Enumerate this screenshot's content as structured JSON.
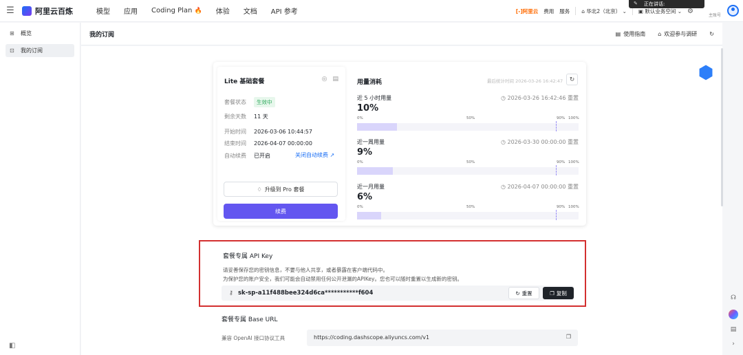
{
  "topbar": {
    "brand": "阿里云百炼",
    "tabs": [
      "模型",
      "应用",
      "Coding Plan",
      "体验",
      "文档",
      "API 参考"
    ],
    "aliyun_logo": "[-]阿里云",
    "fee": "费用",
    "service": "服务",
    "region": "华北2（北京）",
    "workspace": "默认业务空间",
    "speaking": "正在讲话:",
    "account": "主账号"
  },
  "sidebar": {
    "items": [
      {
        "label": "概览",
        "icon": "grid-icon"
      },
      {
        "label": "我的订阅",
        "icon": "subscription-icon"
      }
    ]
  },
  "header": {
    "title": "我的订阅",
    "guide": "使用指南",
    "survey": "欢迎参与调研"
  },
  "plan": {
    "title": "Lite 基础套餐",
    "status_label": "套餐状态",
    "status_value": "生效中",
    "days_label": "剩余天数",
    "days_value": "11 天",
    "start_label": "开始时间",
    "start_value": "2026-03-06 10:44:57",
    "end_label": "结束时间",
    "end_value": "2026-04-07 00:00:00",
    "auto_label": "自动续费",
    "auto_value": "已开启",
    "auto_link": "关闭自动续费",
    "upgrade": "升级到 Pro 套餐",
    "pay": "续费"
  },
  "usage": {
    "title": "用量消耗",
    "stat_time": "最后统计时间 2026-03-26 16:42:47",
    "ticks": [
      "0%",
      "50%",
      "90%",
      "100%"
    ],
    "blocks": [
      {
        "label": "近 5 小时用量",
        "reset": "2026-03-26 16:42:46 重置",
        "pct": "10%",
        "value": 0.1
      },
      {
        "label": "近一周用量",
        "reset": "2026-03-30 00:00:00 重置",
        "pct": "9%",
        "value": 0.09
      },
      {
        "label": "近一月用量",
        "reset": "2026-04-07 00:00:00 重置",
        "pct": "6%",
        "value": 0.06
      }
    ]
  },
  "apikey": {
    "title": "套餐专属 API Key",
    "desc1": "请妥善保存您的密钥信息，不要与他人共享，或者暴露在客户端代码中。",
    "desc2": "为保护您的账户安全，我们可能会自动禁用任何公开泄漏的APIKey。您也可以随时重置以生成新的密钥。",
    "key": "sk-sp-a11f488bee324d6ca***********f604",
    "reset": "重置",
    "copy": "复制"
  },
  "baseurl": {
    "title": "套餐专属 Base URL",
    "label": "兼容 OpenAI 接口协议工具",
    "url": "https://coding.dashscope.aliyuncs.com/v1"
  }
}
